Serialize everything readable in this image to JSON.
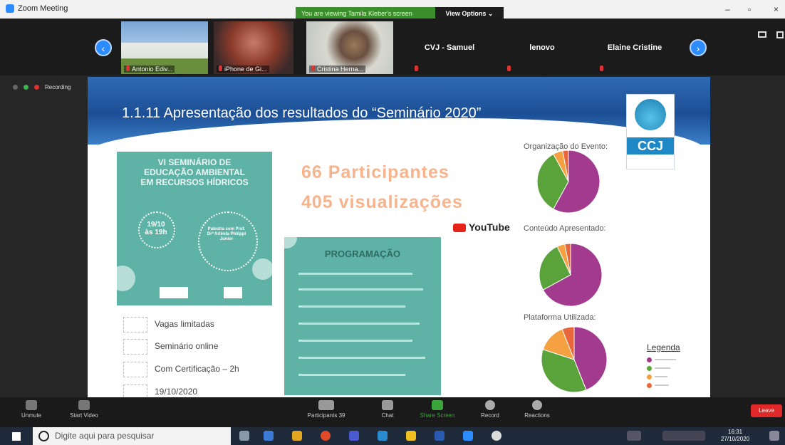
{
  "window": {
    "title": "Zoom Meeting",
    "minimize": "–",
    "restore": "▫",
    "close": "×"
  },
  "banner": {
    "viewing_text": "You are viewing Tamila Kleber's screen",
    "view_options": "View Options ⌄"
  },
  "participants_strip": {
    "prev": "‹",
    "next": "›",
    "tiles": [
      {
        "name": "Antonio Ediv..."
      },
      {
        "name": "iPhone de Gi..."
      },
      {
        "name": "Cristina Herna..."
      }
    ],
    "name_tiles": [
      {
        "name": "CVJ - Samuel"
      },
      {
        "name": "lenovo"
      },
      {
        "name": "Elaine Cristine"
      }
    ]
  },
  "recording": {
    "label": "Recording"
  },
  "slide": {
    "title": "1.1.11 Apresentação dos resultados do “Seminário 2020”",
    "logo": {
      "text": "CCJ"
    },
    "poster": {
      "title_lines": [
        "VI SEMINÁRIO DE",
        "EDUCAÇÃO AMBIENTAL",
        "EM RECURSOS HÍDRICOS"
      ],
      "date_line1": "19/10",
      "date_line2": "às 19h",
      "palestra": "Palestra com Prof. Drª Arlinda Philippi Junior"
    },
    "features": [
      {
        "text": "Vagas limitadas"
      },
      {
        "text": "Seminário online"
      },
      {
        "text": "Com Certificação – 2h"
      },
      {
        "text": "19/10/2020"
      }
    ],
    "stats": {
      "participants": "66 Participantes",
      "views": "405 visualizações",
      "youtube": "YouTube"
    },
    "programacao": {
      "heading": "PROGRAMAÇÃO"
    },
    "pie_labels": [
      "Organização do Evento:",
      "Conteúdo Apresentado:",
      "Plataforma Utilizada:"
    ],
    "legend": {
      "title": "Legenda"
    }
  },
  "controls": {
    "unmute": "Unmute",
    "start_video": "Start Video",
    "participants": "Participants",
    "participants_count": "39",
    "chat": "Chat",
    "share_screen": "Share Screen",
    "record": "Record",
    "reactions": "Reactions",
    "leave": "Leave"
  },
  "taskbar": {
    "search_placeholder": "Digite aqui para pesquisar",
    "time": "16:31",
    "date": "27/10/2020"
  },
  "chart_data": [
    {
      "type": "pie",
      "title": "Organização do Evento:",
      "values": [
        58,
        34,
        5,
        3
      ],
      "colors": [
        "#a23a8e",
        "#5aa23a",
        "#f5a142",
        "#e8673a"
      ]
    },
    {
      "type": "pie",
      "title": "Conteúdo Apresentado:",
      "values": [
        67,
        26,
        4,
        3
      ],
      "colors": [
        "#a23a8e",
        "#5aa23a",
        "#f5a142",
        "#e8673a"
      ]
    },
    {
      "type": "pie",
      "title": "Plataforma Utilizada:",
      "values": [
        44,
        36,
        14,
        6
      ],
      "colors": [
        "#a23a8e",
        "#5aa23a",
        "#f5a142",
        "#e8673a"
      ]
    }
  ]
}
